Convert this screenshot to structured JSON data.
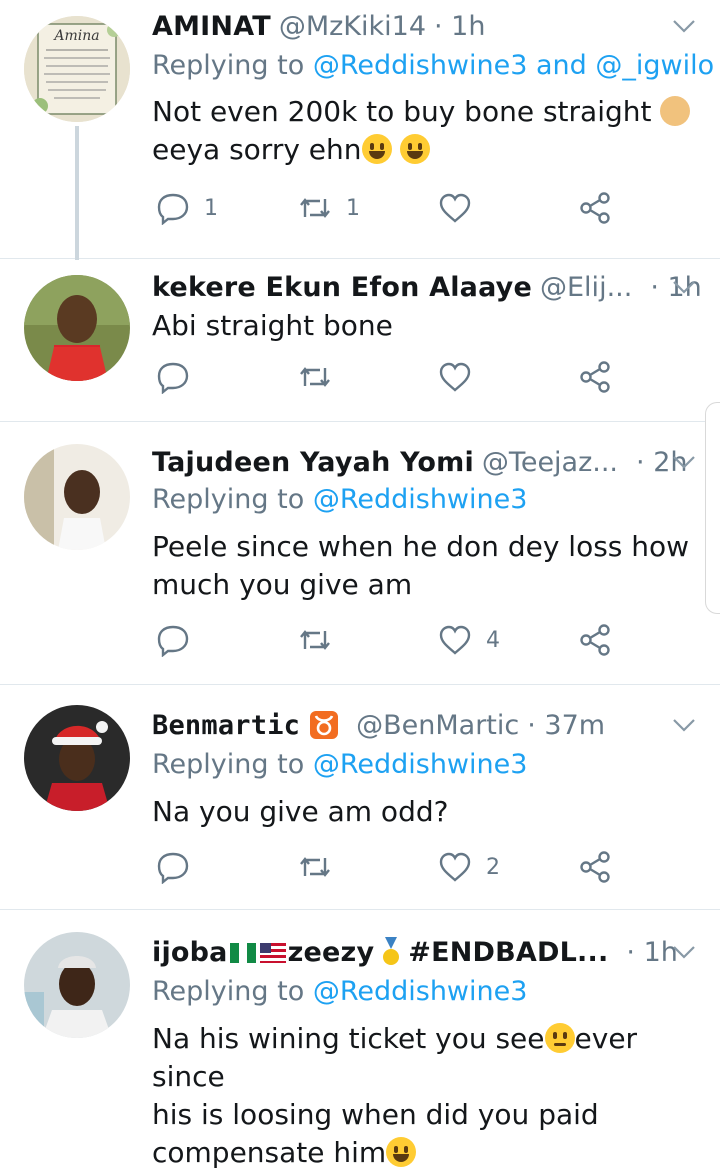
{
  "tweets": [
    {
      "name": "AMINAT",
      "handle": "@MzKiki14",
      "time": "· 1h",
      "reply_prefix": "Replying to",
      "reply_to": "@Reddishwine3 and @_igwilo",
      "text_line1": "Not even 200k to buy bone straight",
      "text_line2": "eeya sorry ehn",
      "replies": "1",
      "retweets": "1",
      "likes": "",
      "avatar_text": "Amina"
    },
    {
      "name": "kekere Ekun Efon Alaaye",
      "handle": "@Elij...",
      "time": "· 1h",
      "text_line1": "Abi straight bone",
      "replies": "",
      "retweets": "",
      "likes": ""
    },
    {
      "name": "Tajudeen Yayah Yomi",
      "handle": "@Teejaz...",
      "time": "· 2h",
      "reply_prefix": "Replying to",
      "reply_to": "@Reddishwine3",
      "text_line1": "Peele since when he don dey loss how",
      "text_line2": "much you give am",
      "replies": "",
      "retweets": "",
      "likes": "4"
    },
    {
      "name": "Benmartic",
      "handle": "@BenMartic",
      "time": "· 37m",
      "reply_prefix": "Replying to",
      "reply_to": "@Reddishwine3",
      "text_line1": "Na you give am odd?",
      "replies": "",
      "retweets": "",
      "likes": "2"
    },
    {
      "name_part1": "ijoba",
      "name_part2": "zeezy",
      "name_part3": "#ENDBADL...",
      "time": "· 1h",
      "reply_prefix": "Replying to",
      "reply_to": "@Reddishwine3",
      "text_line1a": "Na his wining ticket you see",
      "text_line1b": "ever since",
      "text_line2": "his is loosing when did you paid",
      "text_line3": "compensate him"
    }
  ],
  "colors": {
    "link": "#1da1f2",
    "secondary": "#657786",
    "divider": "#e1e8ed"
  },
  "icons": [
    "reply-icon",
    "retweet-icon",
    "like-icon",
    "share-icon",
    "chevron-down-icon"
  ]
}
